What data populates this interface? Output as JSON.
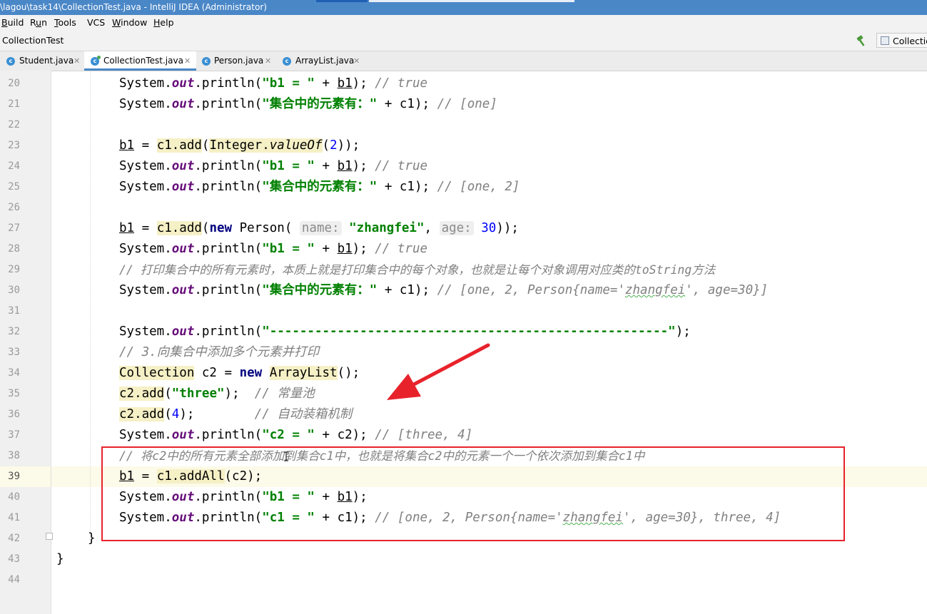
{
  "window": {
    "title": "\\lagou\\task14\\CollectionTest.java - IntelliJ IDEA (Administrator)"
  },
  "menu": {
    "items": [
      "Build",
      "Run",
      "Tools",
      "VCS",
      "Window",
      "Help"
    ],
    "mnemonics": [
      "B",
      "u",
      "T",
      "",
      "W",
      "H"
    ]
  },
  "navbar": {
    "breadcrumb": "CollectionTest",
    "run_config": "CollectionTest"
  },
  "tabs": [
    {
      "label": "Student.java",
      "icon": "class-icon"
    },
    {
      "label": "CollectionTest.java",
      "icon": "runnable-class-icon",
      "active": true
    },
    {
      "label": "Person.java",
      "icon": "class-icon"
    },
    {
      "label": "ArrayList.java",
      "icon": "class-icon"
    }
  ],
  "editor": {
    "line_numbers": [
      "20",
      "21",
      "22",
      "23",
      "24",
      "25",
      "26",
      "27",
      "28",
      "29",
      "30",
      "31",
      "32",
      "33",
      "34",
      "35",
      "36",
      "37",
      "38",
      "39",
      "40",
      "41",
      "42",
      "43",
      "44"
    ],
    "current_line": "39",
    "code": {
      "l20_str": "\"b1 = \"",
      "l20_cmt": "// true",
      "l21_str": "\"集合中的元素有：\"",
      "l21_cmt": "// [one]",
      "l23_num": "2",
      "l24_str": "\"b1 = \"",
      "l24_cmt": "// true",
      "l25_str": "\"集合中的元素有：\"",
      "l25_cmt": "// [one, 2]",
      "l27_hint1": "name:",
      "l27_str": "\"zhangfei\"",
      "l27_hint2": "age:",
      "l27_num": "30",
      "l28_str": "\"b1 = \"",
      "l28_cmt": "// true",
      "l29_cmt": "// 打印集合中的所有元素时，本质上就是打印集合中的每个对象，也就是让每个对象调用对应类的toString方法",
      "l30_str": "\"集合中的元素有：\"",
      "l30_cmt_a": "// [one, 2, Person{name='",
      "l30_cmt_b": "zhangfei",
      "l30_cmt_c": "', age=30}]",
      "l32_str": "\"-----------------------------------------------------\"",
      "l33_cmt": "// 3.向集合中添加多个元素并打印",
      "l35_str": "\"three\"",
      "l35_cmt": "// 常量池",
      "l36_num": "4",
      "l36_cmt": "// 自动装箱机制",
      "l37_str": "\"c2 = \"",
      "l37_cmt": "// [three, 4]",
      "l38_cmt": "// 将c2中的所有元素全部添加到集合c1中，也就是将集合c2中的元素一个一个依次添加到集合c1中",
      "l40_str": "\"b1 = \"",
      "l41_str": "\"c1 = \"",
      "l41_cmt_a": "// [one, 2, Person{name='",
      "l41_cmt_b": "zhangfei",
      "l41_cmt_c": "', age=30}, three, 4]"
    }
  },
  "annotations": {
    "highlight_color": "#e8222b"
  }
}
